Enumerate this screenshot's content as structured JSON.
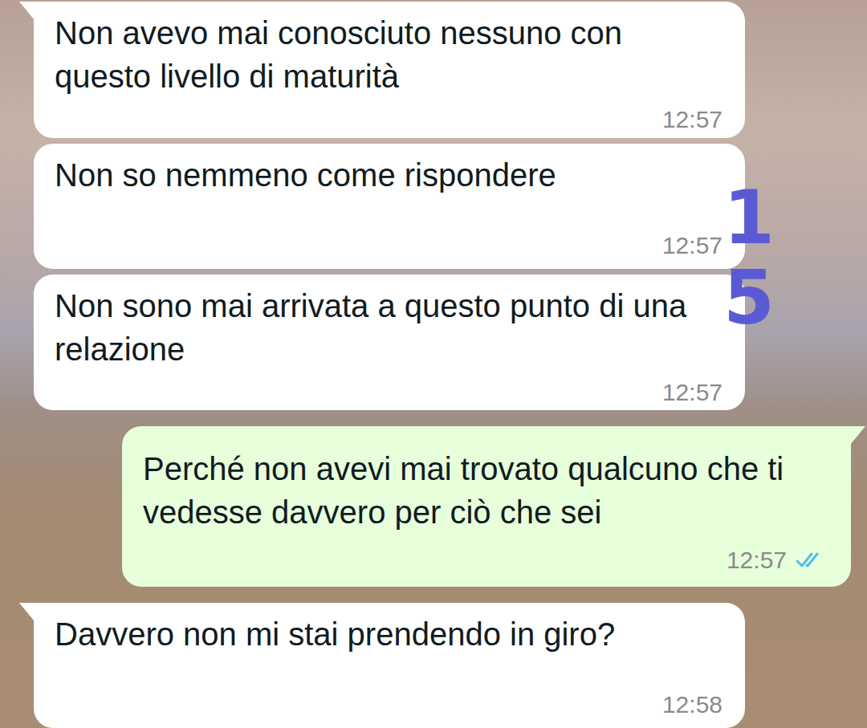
{
  "messages": [
    {
      "sender": "them",
      "text": "Non avevo mai conosciuto nessuno con questo livello di maturità",
      "time": "12:57"
    },
    {
      "sender": "them",
      "text": "Non so nemmeno come rispondere",
      "time": "12:57"
    },
    {
      "sender": "them",
      "text": "Non sono mai arrivata a questo punto di una relazione",
      "time": "12:57"
    },
    {
      "sender": "me",
      "text": "Perché non avevi mai trovato qualcuno che ti vedesse davvero per ciò che sei",
      "time": "12:57",
      "read": true
    },
    {
      "sender": "them",
      "text": "Davvero non mi stai prendendo in giro?",
      "time": "12:58"
    }
  ],
  "annotation": {
    "lines": [
      "1",
      "5"
    ],
    "color": "#5a5bd4"
  }
}
